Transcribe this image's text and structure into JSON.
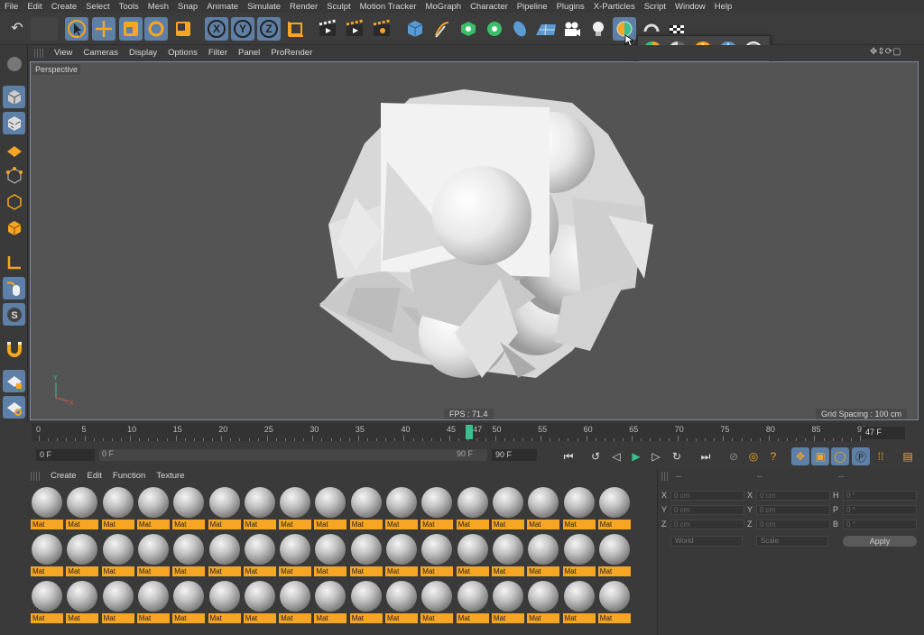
{
  "menu": [
    "File",
    "Edit",
    "Create",
    "Select",
    "Tools",
    "Mesh",
    "Snap",
    "Animate",
    "Simulate",
    "Render",
    "Sculpt",
    "Motion Tracker",
    "MoGraph",
    "Character",
    "Pipeline",
    "Plugins",
    "X-Particles",
    "Script",
    "Window",
    "Help"
  ],
  "toolbar": {
    "undo_icon": "undo-icon",
    "axis_x": "X",
    "axis_y": "Y",
    "axis_z": "Z"
  },
  "viewport_menu": [
    "View",
    "Cameras",
    "Display",
    "Options",
    "Filter",
    "Panel",
    "ProRender"
  ],
  "viewport": {
    "label": "Perspective",
    "fps": "FPS : 71.4",
    "grid_spacing": "Grid Spacing : 100 cm"
  },
  "timeline": {
    "ticks": [
      "0",
      "5",
      "10",
      "15",
      "20",
      "25",
      "30",
      "35",
      "40",
      "45",
      "50",
      "55",
      "60",
      "65",
      "70",
      "75",
      "80",
      "85",
      "90"
    ],
    "current": "47",
    "current_field": "47 F"
  },
  "transport": {
    "start": "0 F",
    "range_start": "0 F",
    "range_end": "90 F",
    "end": "90 F"
  },
  "material_menu": [
    "Create",
    "Edit",
    "Function",
    "Texture"
  ],
  "material_label": "Mat",
  "attributes": {
    "headers": [
      "--",
      "--",
      "--"
    ],
    "rows": [
      {
        "l1": "X",
        "v1": "0 cm",
        "l2": "X",
        "v2": "0 cm",
        "l3": "H",
        "v3": "0 °"
      },
      {
        "l1": "Y",
        "v1": "0 cm",
        "l2": "Y",
        "v2": "0 cm",
        "l3": "P",
        "v3": "0 °"
      },
      {
        "l1": "Z",
        "v1": "0 cm",
        "l2": "Z",
        "v2": "0 cm",
        "l3": "B",
        "v3": "0 °"
      }
    ],
    "coord_system": "World",
    "size_mode": "Scale",
    "apply": "Apply"
  },
  "colors": {
    "accent_blue": "#5e7fa6",
    "material_tag": "#f6a623",
    "playhead": "#3bbf8c"
  }
}
